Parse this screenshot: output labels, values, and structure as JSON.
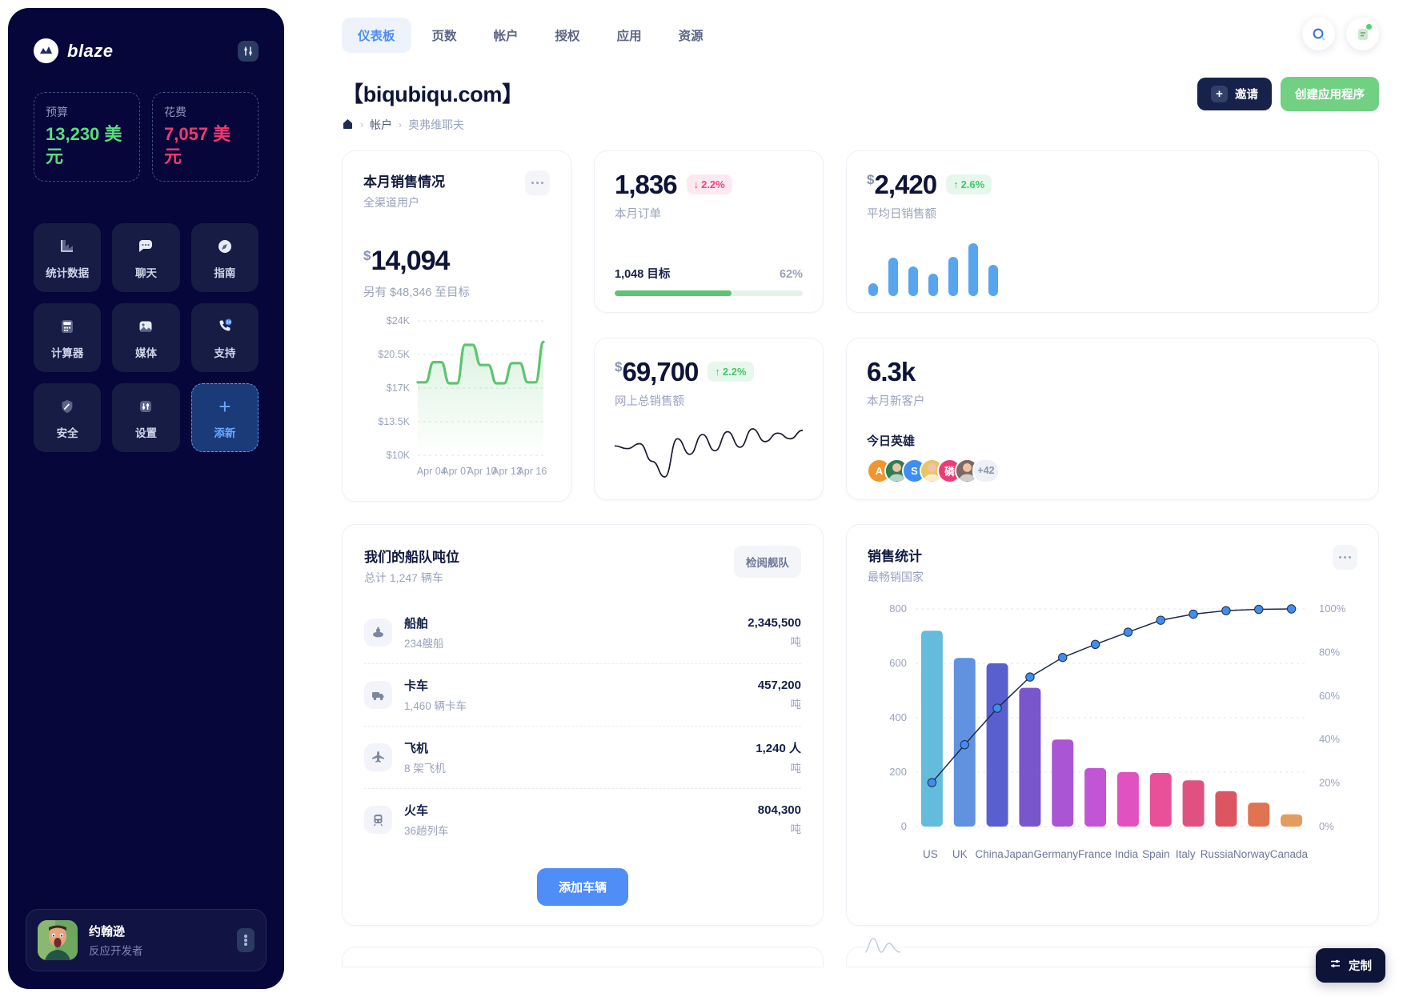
{
  "sidebar": {
    "brand": "blaze",
    "brand_icon": "blaze-logo-icon",
    "settings_icon": "sliders-icon",
    "budget": {
      "label": "预算",
      "value": "13,230 美元",
      "color": "#5ddc7d"
    },
    "spend": {
      "label": "花费",
      "value": "7,057 美元",
      "color": "#f6386f"
    },
    "tiles": [
      {
        "label": "统计数据",
        "icon": "bar-chart-icon"
      },
      {
        "label": "聊天",
        "icon": "chat-bubble-icon"
      },
      {
        "label": "指南",
        "icon": "compass-icon"
      },
      {
        "label": "计算器",
        "icon": "calculator-icon"
      },
      {
        "label": "媒体",
        "icon": "image-icon"
      },
      {
        "label": "支持",
        "icon": "phone-24-icon"
      },
      {
        "label": "安全",
        "icon": "shield-icon"
      },
      {
        "label": "设置",
        "icon": "sliders-icon"
      },
      {
        "label": "添新",
        "icon": "plus-icon"
      }
    ],
    "profile": {
      "name": "约翰逊",
      "role": "反应开发者",
      "menu_icon": "kebab-menu-icon"
    }
  },
  "header": {
    "tabs": [
      {
        "label": "仪表板",
        "active": true
      },
      {
        "label": "页数",
        "active": false
      },
      {
        "label": "帐户",
        "active": false
      },
      {
        "label": "授权",
        "active": false
      },
      {
        "label": "应用",
        "active": false
      },
      {
        "label": "资源",
        "active": false
      }
    ],
    "search_icon": "search-icon",
    "notifications_icon": "note-icon",
    "title": "【biqubiqu.com】",
    "breadcrumb": {
      "home_icon": "home-icon",
      "items": [
        "帐户",
        "奥弗维耶夫"
      ],
      "separator": "›"
    },
    "invite_button": "邀请",
    "invite_icon": "plus-icon",
    "create_button": "创建应用程序"
  },
  "cards": {
    "orders": {
      "value": "1,836",
      "delta": "2.2%",
      "delta_dir": "down",
      "label": "本月订单",
      "goal_label": "1,048 目标",
      "goal_pct": "62%",
      "goal_fill": 62
    },
    "avg_sale": {
      "currency": "$",
      "value": "2,420",
      "delta": "2.6%",
      "delta_dir": "up",
      "label": "平均日销售额"
    },
    "online": {
      "currency": "$",
      "value": "69,700",
      "delta": "2.2%",
      "delta_dir": "up",
      "label": "网上总销售额"
    },
    "customers": {
      "value": "6.3k",
      "label": "本月新客户",
      "heroes_label": "今日英雄",
      "heroes_more": "+42",
      "heroes": [
        {
          "initial": "A",
          "color": "#f0962e"
        },
        {
          "initial": "",
          "color": "#2f7d54"
        },
        {
          "initial": "S",
          "color": "#3d8ef0"
        },
        {
          "initial": "",
          "color": "#e9c56a"
        },
        {
          "initial": "磷",
          "color": "#ee3c78"
        },
        {
          "initial": "",
          "color": "#7a6a63"
        }
      ]
    },
    "sales_month": {
      "title": "本月销售情况",
      "subtitle": "全渠道用户",
      "currency": "$",
      "amount": "14,094",
      "remaining": "另有 $48,346 至目标",
      "menu_icon": "ellipsis-icon"
    },
    "fleet": {
      "title": "我们的船队吨位",
      "subtitle": "总计 1,247 辆车",
      "chip": "检阅舰队",
      "add_button": "添加车辆",
      "rows": [
        {
          "icon": "ship-icon",
          "name": "船舶",
          "count": "234艘船",
          "amount": "2,345,500",
          "unit": "吨"
        },
        {
          "icon": "truck-icon",
          "name": "卡车",
          "count": "1,460 辆卡车",
          "amount": "457,200",
          "unit": "吨"
        },
        {
          "icon": "plane-icon",
          "name": "飞机",
          "count": "8 架飞机",
          "amount": "1,240 人",
          "unit": "吨"
        },
        {
          "icon": "train-icon",
          "name": "火车",
          "count": "36趟列车",
          "amount": "804,300",
          "unit": "吨"
        }
      ]
    },
    "sales_stats": {
      "title": "销售统计",
      "subtitle": "最畅销国家",
      "menu_icon": "ellipsis-icon"
    }
  },
  "fab": {
    "label": "定制",
    "icon": "sliders-icon"
  },
  "chart_data": [
    {
      "type": "area",
      "title": "本月销售情况",
      "subtitle": "全渠道用户",
      "ylabel": "",
      "xlabel": "",
      "ytick_labels": [
        "$24K",
        "$20.5K",
        "$17K",
        "$13.5K",
        "$10K"
      ],
      "ytick_values": [
        24000,
        20500,
        17000,
        13500,
        10000
      ],
      "ylim": [
        10000,
        24000
      ],
      "xtick_labels": [
        "Apr 04",
        "Apr 07",
        "Apr 10",
        "Apr 13",
        "Apr 16"
      ],
      "grid": true,
      "legend": "none",
      "line_color": "#5dc46f",
      "values": [
        17600,
        17600,
        19700,
        19700,
        17500,
        17500,
        21500,
        21500,
        19400,
        19400,
        17500,
        17500,
        19600,
        19600,
        17600,
        17600,
        21800
      ]
    },
    {
      "type": "bar",
      "title": "销售统计",
      "subtitle": "最畅销国家",
      "categories": [
        "US",
        "UK",
        "China",
        "Japan",
        "Germany",
        "France",
        "India",
        "Spain",
        "Italy",
        "Russia",
        "Norway",
        "Canada"
      ],
      "values": [
        720,
        620,
        600,
        510,
        320,
        215,
        200,
        197,
        170,
        130,
        88,
        45
      ],
      "bar_colors": [
        "#63bcdc",
        "#6192e0",
        "#5a5fd0",
        "#7a56cd",
        "#a955d4",
        "#c254d6",
        "#e052c0",
        "#e8519a",
        "#e05080",
        "#dd5560",
        "#e07350",
        "#e59a5e"
      ],
      "ylim": [
        0,
        800
      ],
      "ytick_labels": [
        "0",
        "200",
        "400",
        "600",
        "800"
      ],
      "ytick_values": [
        0,
        200,
        400,
        600,
        800
      ],
      "secondary_axis": {
        "name": "cumulative",
        "ytick_labels": [
          "0%",
          "20%",
          "40%",
          "60%",
          "80%",
          "100%"
        ],
        "ytick_values": [
          0,
          20,
          40,
          60,
          80,
          100
        ],
        "values": [
          20.2,
          37.6,
          54.4,
          68.7,
          77.7,
          83.7,
          89.3,
          94.8,
          97.6,
          99.2,
          99.8,
          100
        ],
        "line_color": "#1e2a4a",
        "marker_color": "#3d8ef0"
      },
      "grid": true,
      "legend": "none"
    },
    {
      "type": "bar",
      "title": "平均日销售额",
      "categories": [
        "1",
        "2",
        "3",
        "4",
        "5",
        "6",
        "7"
      ],
      "values": [
        16,
        47,
        36,
        28,
        48,
        65,
        38
      ],
      "bar_colors": [
        "#57a5ef"
      ],
      "grid": false,
      "legend": "none"
    },
    {
      "type": "line",
      "title": "网上总销售额",
      "values": [
        52,
        48,
        55,
        30,
        8,
        62,
        40,
        68,
        45,
        72,
        50,
        76,
        58,
        70,
        62,
        74
      ],
      "line_color": "#1a1a2e",
      "grid": false,
      "legend": "none"
    }
  ]
}
